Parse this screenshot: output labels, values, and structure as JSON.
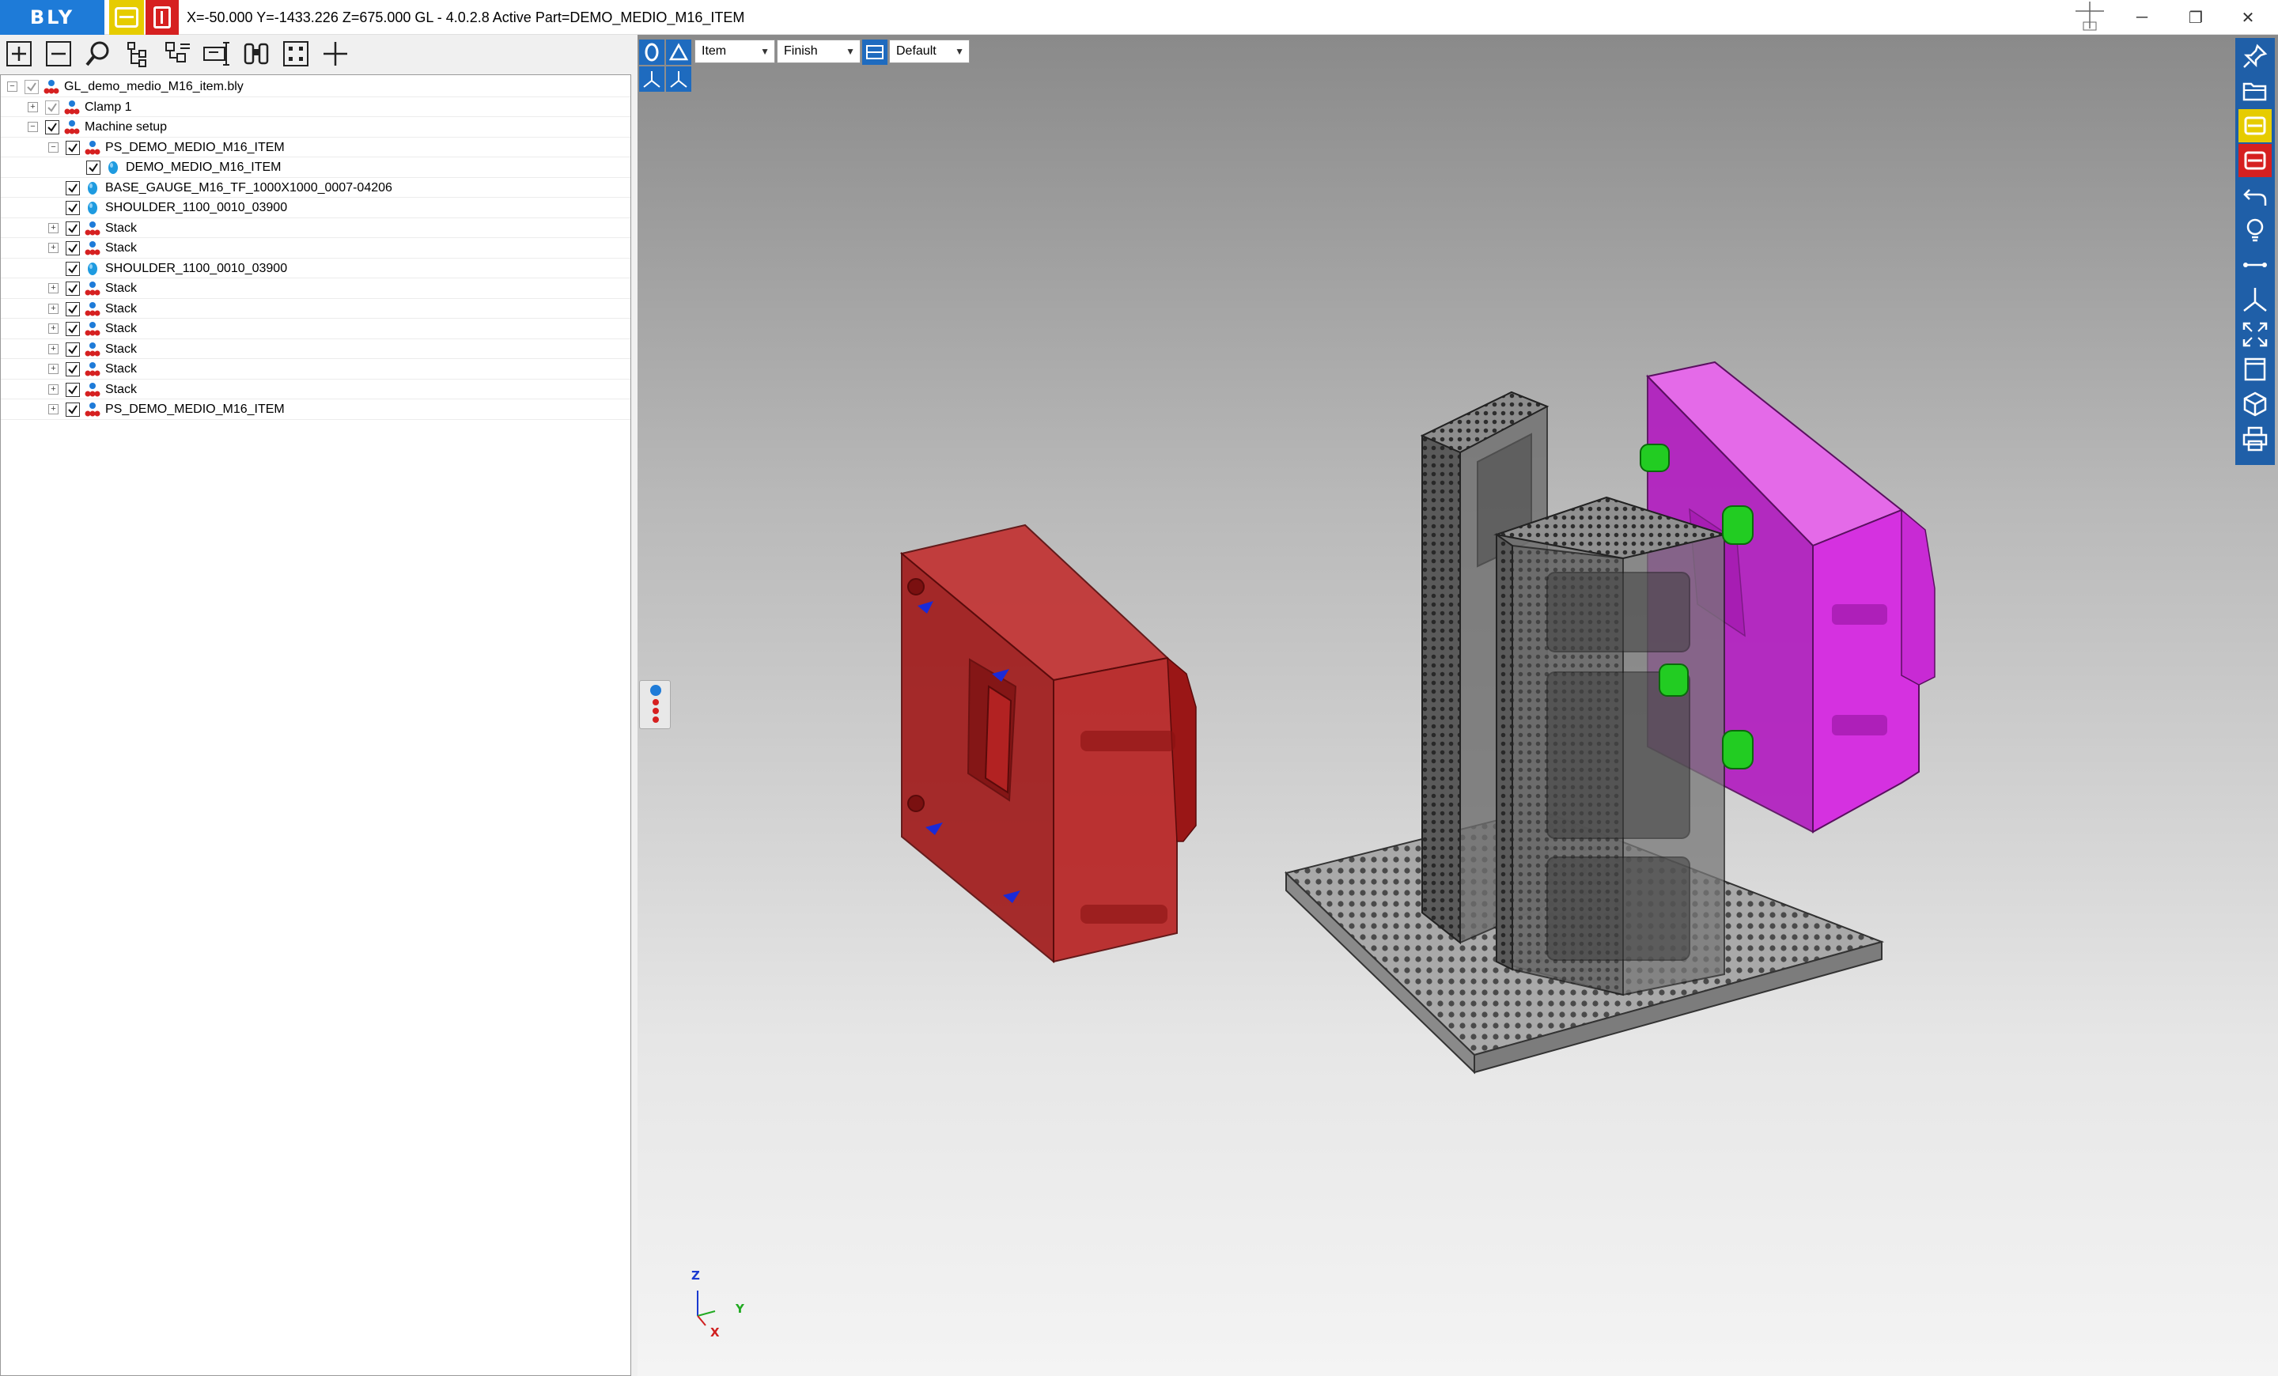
{
  "titlebar": {
    "logo_text": "BLY",
    "title": "X=-50.000 Y=-1433.226 Z=675.000   GL - 4.0.2.8 Active Part=DEMO_MEDIO_M16_ITEM",
    "minimize": "─",
    "maximize": "❐",
    "close": "✕"
  },
  "tree_toolbar": {
    "icons": [
      "expand-icon",
      "collapse-icon",
      "search-icon",
      "tree-up-icon",
      "tree-down-icon",
      "rename-icon",
      "binoculars-icon",
      "fit-icon",
      "add-icon"
    ]
  },
  "tree": {
    "items": [
      {
        "label": "GL_demo_medio_M16_item.bly",
        "level": 0,
        "expander": "−",
        "checked": true,
        "dim": true,
        "icon": "assembly"
      },
      {
        "label": "Clamp 1",
        "level": 1,
        "expander": "+",
        "checked": true,
        "dim": true,
        "icon": "assembly"
      },
      {
        "label": "Machine setup",
        "level": 1,
        "expander": "−",
        "checked": true,
        "dim": false,
        "icon": "assembly"
      },
      {
        "label": "PS_DEMO_MEDIO_M16_ITEM",
        "level": 2,
        "expander": "−",
        "checked": true,
        "dim": false,
        "icon": "assembly"
      },
      {
        "label": "DEMO_MEDIO_M16_ITEM",
        "level": 3,
        "expander": "",
        "checked": true,
        "dim": false,
        "icon": "part"
      },
      {
        "label": "BASE_GAUGE_M16_TF_1000X1000_0007-04206",
        "level": 2,
        "expander": "",
        "checked": true,
        "dim": false,
        "icon": "part"
      },
      {
        "label": "SHOULDER_1100_0010_03900",
        "level": 2,
        "expander": "",
        "checked": true,
        "dim": false,
        "icon": "part"
      },
      {
        "label": "Stack",
        "level": 2,
        "expander": "+",
        "checked": true,
        "dim": false,
        "icon": "assembly"
      },
      {
        "label": "Stack",
        "level": 2,
        "expander": "+",
        "checked": true,
        "dim": false,
        "icon": "assembly"
      },
      {
        "label": "SHOULDER_1100_0010_03900",
        "level": 2,
        "expander": "",
        "checked": true,
        "dim": false,
        "icon": "part"
      },
      {
        "label": "Stack",
        "level": 2,
        "expander": "+",
        "checked": true,
        "dim": false,
        "icon": "assembly"
      },
      {
        "label": "Stack",
        "level": 2,
        "expander": "+",
        "checked": true,
        "dim": false,
        "icon": "assembly"
      },
      {
        "label": "Stack",
        "level": 2,
        "expander": "+",
        "checked": true,
        "dim": false,
        "icon": "assembly"
      },
      {
        "label": "Stack",
        "level": 2,
        "expander": "+",
        "checked": true,
        "dim": false,
        "icon": "assembly"
      },
      {
        "label": "Stack",
        "level": 2,
        "expander": "+",
        "checked": true,
        "dim": false,
        "icon": "assembly"
      },
      {
        "label": "Stack",
        "level": 2,
        "expander": "+",
        "checked": true,
        "dim": false,
        "icon": "assembly"
      },
      {
        "label": "PS_DEMO_MEDIO_M16_ITEM",
        "level": 2,
        "expander": "+",
        "checked": true,
        "dim": false,
        "icon": "assembly"
      }
    ]
  },
  "view_toolbar": {
    "selection_mode": "Item",
    "stage": "Finish",
    "view_preset": "Default"
  },
  "right_toolbar": {
    "icons": [
      "pin-icon",
      "open-folder-icon",
      "yellow-b-icon",
      "red-b-icon",
      "undo-icon",
      "bulb-icon",
      "measure-icon",
      "axes-icon",
      "fit-all-icon",
      "window-icon",
      "cube-icon",
      "print-icon"
    ]
  },
  "axes": {
    "z": "Z",
    "y": "Y",
    "x": "X"
  },
  "colors": {
    "brand_blue": "#1e7bd8",
    "brand_yellow": "#e6cc00",
    "brand_red": "#d62020",
    "red_part": "#a01818",
    "magenta_part": "#d020d8",
    "green_clamp": "#22cc22"
  }
}
